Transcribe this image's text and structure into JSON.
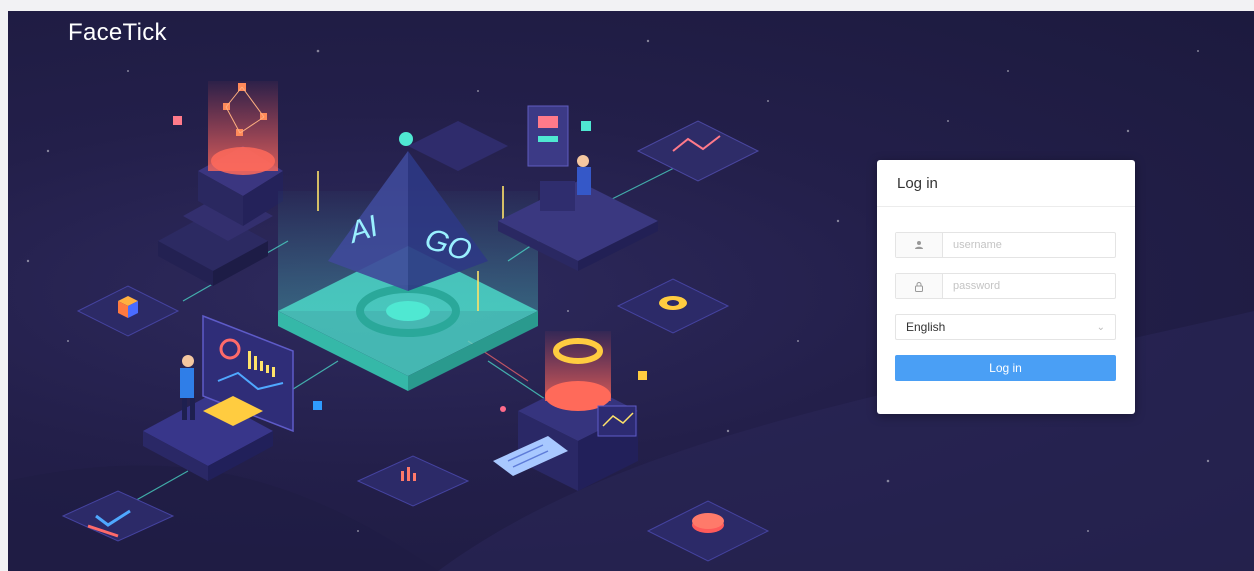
{
  "app": {
    "brand": "FaceTick"
  },
  "illustration": {
    "pyramid_left_text": "AI",
    "pyramid_right_text": "GO"
  },
  "login": {
    "title": "Log in",
    "username_placeholder": "username",
    "password_placeholder": "password",
    "language": "English",
    "submit_label": "Log in",
    "icons": {
      "username": "user-icon",
      "password": "lock-icon",
      "language": "chevron-down-icon"
    }
  },
  "colors": {
    "background": "#231f4a",
    "accent_cyan": "#4fe8d2",
    "accent_red": "#ff5a5a",
    "button": "#4a9ff5"
  }
}
